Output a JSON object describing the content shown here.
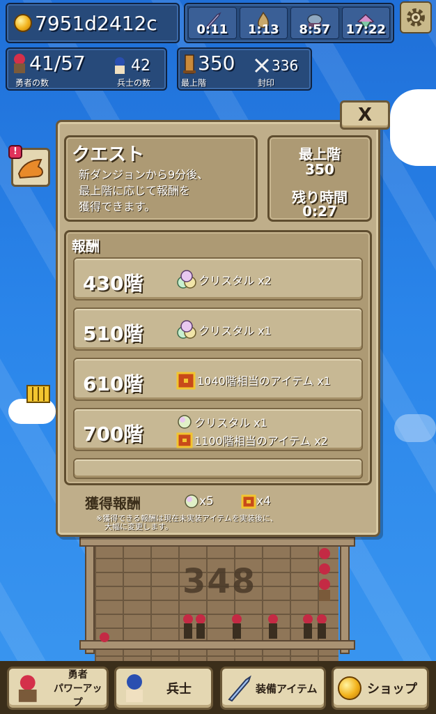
{
  "hud": {
    "gold": "7951d2412c",
    "timers": [
      {
        "icon": "sword-icon",
        "value": "0:11"
      },
      {
        "icon": "flame-icon",
        "value": "1:13"
      },
      {
        "icon": "ship-icon",
        "value": "8:57"
      },
      {
        "icon": "crystal-cluster-icon",
        "value": "17:22"
      }
    ],
    "heroes": {
      "value": "41/57",
      "caption": "勇者の数"
    },
    "soldiers": {
      "value": "42",
      "caption": "兵士の数"
    },
    "top_floor": {
      "value": "350",
      "caption": "最上階"
    },
    "seal": {
      "value": "336",
      "caption": "封印"
    }
  },
  "dialog": {
    "close_label": "X",
    "quest": {
      "title": "クエスト",
      "desc_lines": [
        "新ダンジョンから9分後、",
        "最上階に応じて報酬を",
        "獲得できます。"
      ]
    },
    "status": {
      "top_floor_label": "最上階",
      "top_floor_value": "350",
      "time_left_label": "残り時間",
      "time_left_value": "0:27"
    },
    "rewards_title": "報酬",
    "rewards": [
      {
        "floor": "430階",
        "items": [
          {
            "icon": "crystal-icon",
            "text": "クリスタル x2"
          }
        ]
      },
      {
        "floor": "510階",
        "items": [
          {
            "icon": "crystal-icon",
            "text": "クリスタル x1"
          }
        ]
      },
      {
        "floor": "610階",
        "items": [
          {
            "icon": "treasure-chest-icon",
            "text": "1040階相当のアイテム x1"
          }
        ]
      },
      {
        "floor": "700階",
        "items": [
          {
            "icon": "crystal-icon",
            "text": "クリスタル x1"
          },
          {
            "icon": "treasure-chest-icon",
            "text": "1100階相当のアイテム x2"
          }
        ]
      }
    ],
    "earned_label": "獲得報酬",
    "earned_crystal": "x5",
    "earned_chest": "x4",
    "note_lines": [
      "※獲得できる報酬は現在未実装アイテムを実装後に、",
      "大幅に変更します。"
    ]
  },
  "tower": {
    "floor_number": "348"
  },
  "nav": {
    "hero_power_up": [
      "勇者",
      "パワーアップ"
    ],
    "soldier": "兵士",
    "equipment": "装備アイテム",
    "shop": "ショップ"
  },
  "colors": {
    "sky": "#2a85ea",
    "panel": "#bfae8a",
    "hud": "#274a7a"
  }
}
